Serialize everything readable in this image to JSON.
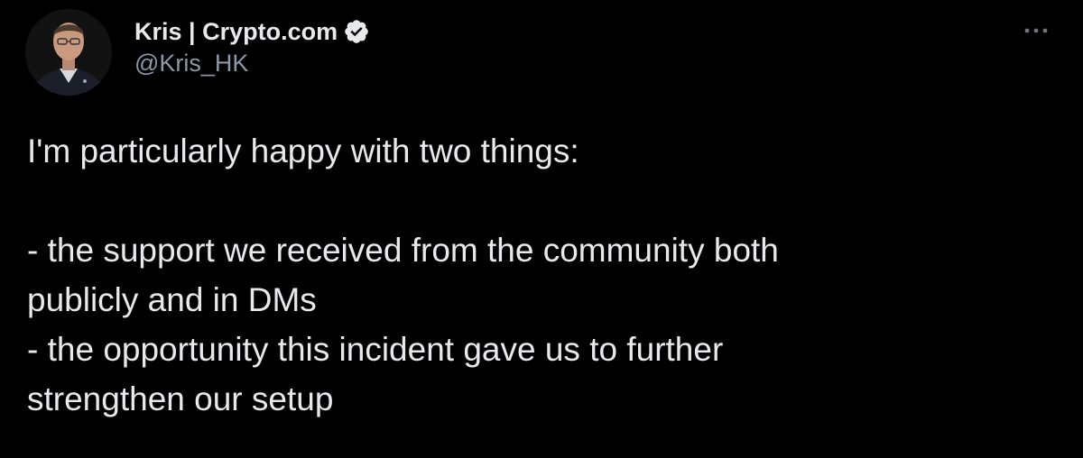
{
  "author": {
    "display_name": "Kris | Crypto.com",
    "handle": "@Kris_HK",
    "verified": true,
    "verified_icon": "verified-badge-icon"
  },
  "actions": {
    "more_icon": "more-horizontal-icon"
  },
  "tweet": {
    "lines": [
      "I'm particularly happy with two things:",
      "",
      "- the support we received from the community both",
      "publicly and in DMs",
      "- the opportunity this incident gave us to further",
      "strengthen our setup"
    ]
  },
  "colors": {
    "background": "#000000",
    "primary_text": "#e7e9ea",
    "secondary_text": "#8b98a5"
  }
}
